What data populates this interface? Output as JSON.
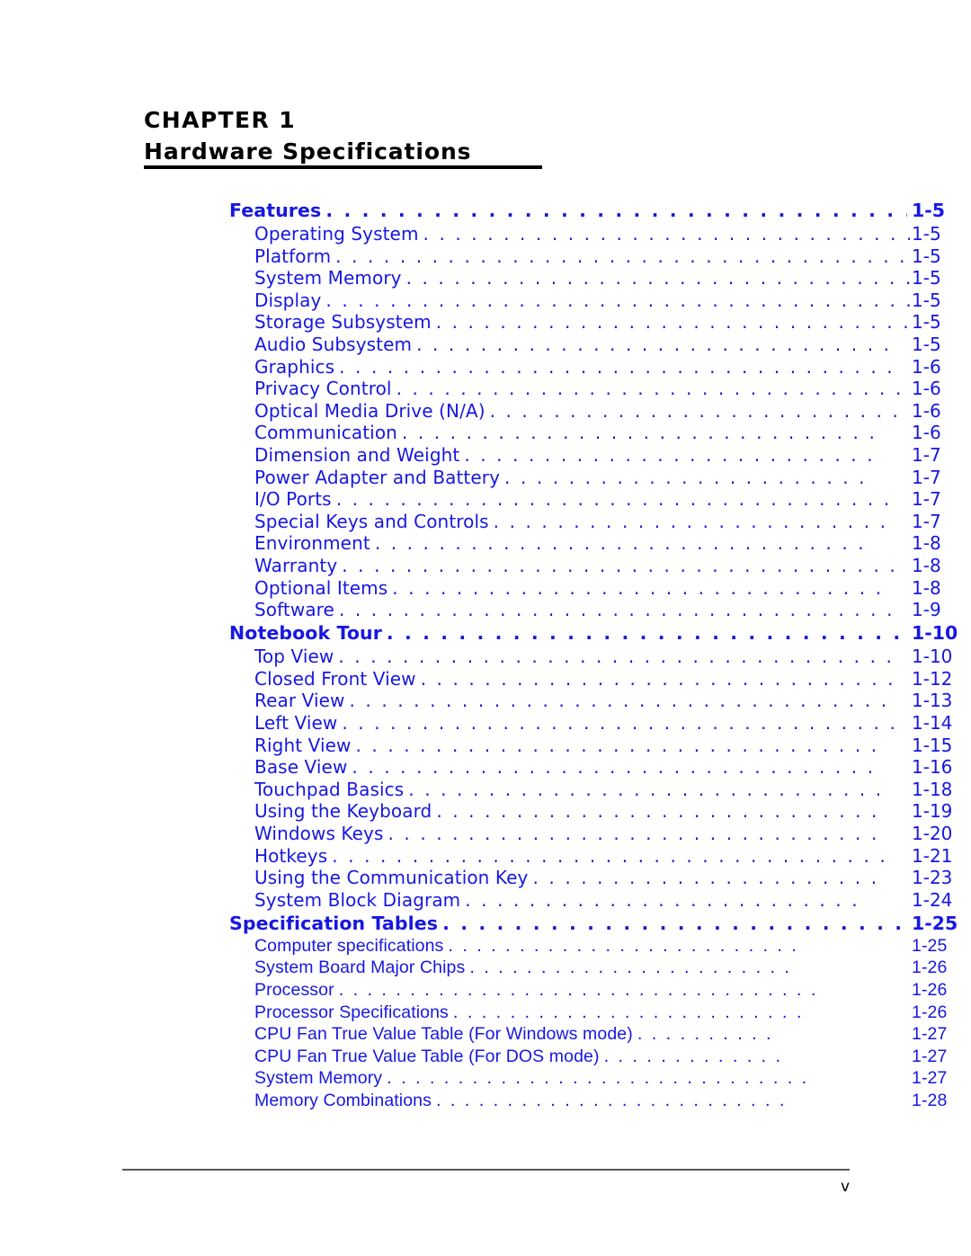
{
  "document": {
    "chapter_label": "CHAPTER 1",
    "chapter_title": "Hardware Specifications",
    "footer_page_number": "v",
    "accent_color": "#1717E2",
    "rule_color": "#000000",
    "footer_rule_color": "#58585A"
  },
  "toc": {
    "entries": [
      {
        "level": 1,
        "label": "Features",
        "page": "1-5",
        "leader": ". . . . . . . . . . . . . . . . . . . . . . . . . . . . . . . . . . ."
      },
      {
        "level": 2,
        "label": "Operating System",
        "page": "1-5",
        "leader": ". . . . . . . . . . . . . . . . . . . . . . . . . . . . . . . . ."
      },
      {
        "level": 2,
        "label": "Platform",
        "page": "1-5",
        "leader": ". . . . . . . . . . . . . . . . . . . . . . . . . . . . . . . . . . . ."
      },
      {
        "level": 2,
        "label": "System Memory",
        "page": "1-5",
        "leader": ". . . . . . . . . . . . . . . . . . . . . . . . . . . . . . . . ."
      },
      {
        "level": 2,
        "label": "Display",
        "page": "1-5",
        "leader": ". . . . . . . . . . . . . . . . . . . . . . . . . . . . . . . . . . . . ."
      },
      {
        "level": 2,
        "label": "Storage Subsystem",
        "page": "1-5",
        "leader": ". . . . . . . . . . . . . . . . . . . . . . . . . . . . . ."
      },
      {
        "level": 2,
        "label": "Audio Subsystem",
        "page": "1-5",
        "leader": ". . . . . . . . . . . . . . . . . . . . . . . . . . . . . ."
      },
      {
        "level": 2,
        "label": "Graphics",
        "page": "1-6",
        "leader": ". . . . . . . . . . . . . . . . . . . . . . . . . . . . . . . . . . ."
      },
      {
        "level": 2,
        "label": "Privacy Control",
        "page": "1-6",
        "leader": ". . . . . . . . . . . . . . . . . . . . . . . . . . . . . . . ."
      },
      {
        "level": 2,
        "label": "Optical Media Drive (N/A)",
        "page": "1-6",
        "leader": ". . . . . . . . . . . . . . . . . . . . . . . . . ."
      },
      {
        "level": 2,
        "label": "Communication",
        "page": "1-6",
        "leader": ". . . . . . . . . . . . . . . . . . . . . . . . . . . . . ."
      },
      {
        "level": 2,
        "label": "Dimension and Weight",
        "page": "1-7",
        "leader": ". . . . . . . . . . . . . . . . . . . . . . . . . ."
      },
      {
        "level": 2,
        "label": "Power Adapter and Battery",
        "page": "1-7",
        "leader": ". . . . . . . . . . . . . . . . . . . . . . ."
      },
      {
        "level": 2,
        "label": "I/O Ports",
        "page": "1-7",
        "leader": ". . . . . . . . . . . . . . . . . . . . . . . . . . . . . . . . . . ."
      },
      {
        "level": 2,
        "label": "Special Keys and Controls",
        "page": "1-7",
        "leader": ". . . . . . . . . . . . . . . . . . . . . . . . ."
      },
      {
        "level": 2,
        "label": "Environment",
        "page": "1-8",
        "leader": ". . . . . . . . . . . . . . . . . . . . . . . . . . . . . . ."
      },
      {
        "level": 2,
        "label": "Warranty",
        "page": "1-8",
        "leader": ". . . . . . . . . . . . . . . . . . . . . . . . . . . . . . . . . . ."
      },
      {
        "level": 2,
        "label": "Optional Items",
        "page": "1-8",
        "leader": ". . . . . . . . . . . . . . . . . . . . . . . . . . . . . . ."
      },
      {
        "level": 2,
        "label": "Software",
        "page": "1-9",
        "leader": ". . . . . . . . . . . . . . . . . . . . . . . . . . . . . . . . . . ."
      },
      {
        "level": 1,
        "label": "Notebook Tour",
        "page": "1-10",
        "leader": ". . . . . . . . . . . . . . . . . . . . . . . . . . . . . . . . . ."
      },
      {
        "level": 2,
        "label": "Top View",
        "page": "1-10",
        "leader": ". . . . . . . . . . . . . . . . . . . . . . . . . . . . . . . . . . ."
      },
      {
        "level": 2,
        "label": "Closed Front View",
        "page": "1-12",
        "leader": ". . . . . . . . . . . . . . . . . . . . . . . . . . . . . ."
      },
      {
        "level": 2,
        "label": "Rear View",
        "page": "1-13",
        "leader": ". . . . . . . . . . . . . . . . . . . . . . . . . . . . . . . . . ."
      },
      {
        "level": 2,
        "label": "Left View",
        "page": "1-14",
        "leader": ". . . . . . . . . . . . . . . . . . . . . . . . . . . . . . . . . . ."
      },
      {
        "level": 2,
        "label": "Right View",
        "page": "1-15",
        "leader": ". . . . . . . . . . . . . . . . . . . . . . . . . . . . . . . . ."
      },
      {
        "level": 2,
        "label": "Base View",
        "page": "1-16",
        "leader": ". . . . . . . . . . . . . . . . . . . . . . . . . . . . . . . . ."
      },
      {
        "level": 2,
        "label": "Touchpad Basics",
        "page": "1-18",
        "leader": ". . . . . . . . . . . . . . . . . . . . . . . . . . . . . ."
      },
      {
        "level": 2,
        "label": "Using the Keyboard",
        "page": "1-19",
        "leader": ". . . . . . . . . . . . . . . . . . . . . . . . . . . ."
      },
      {
        "level": 2,
        "label": "Windows Keys",
        "page": "1-20",
        "leader": ". . . . . . . . . . . . . . . . . . . . . . . . . . . . . . ."
      },
      {
        "level": 2,
        "label": "Hotkeys",
        "page": "1-21",
        "leader": ". . . . . . . . . . . . . . . . . . . . . . . . . . . . . . . . . . ."
      },
      {
        "level": 2,
        "label": "Using the Communication Key",
        "page": "1-23",
        "leader": ". . . . . . . . . . . . . . . . . . . . . ."
      },
      {
        "level": 2,
        "label": "System Block Diagram",
        "page": "1-24",
        "leader": ". . . . . . . . . . . . . . . . . . . . . . . . ."
      },
      {
        "level": 1,
        "label": "Specification Tables",
        "page": "1-25",
        "leader": ". . . . . . . . . . . . . . . . . . . . . . . . . . . . . ."
      },
      {
        "level": 2,
        "label": "Computer specifications",
        "page": "1-25",
        "leader": ". . . . . . . . . . . . . . . . . . . . . . . . ."
      },
      {
        "level": 2,
        "label": "System Board Major Chips",
        "page": "1-26",
        "leader": ". . . . . . . . . . . . . . . . . . . . . . ."
      },
      {
        "level": 2,
        "label": "Processor",
        "page": "1-26",
        "leader": ". . . . . . . . . . . . . . . . . . . . . . . . . . . . . . . . . ."
      },
      {
        "level": 2,
        "label": "Processor Specifications",
        "page": "1-26",
        "leader": ". . . . . . . . . . . . . . . . . . . . . . . . ."
      },
      {
        "level": 2,
        "label": "CPU Fan True Value Table (For Windows mode)",
        "page": "1-27",
        "leader": ". . . . . . . . . ."
      },
      {
        "level": 2,
        "label": "CPU Fan True Value Table (For DOS mode)",
        "page": "1-27",
        "leader": ". . . . . . . . . . . . ."
      },
      {
        "level": 2,
        "label": "System Memory",
        "page": "1-27",
        "leader": ". . . . . . . . . . . . . . . . . . . . . . . . . . . . . ."
      },
      {
        "level": 2,
        "label": "Memory Combinations",
        "page": "1-28",
        "leader": ". . . . . . . . . . . . . . . . . . . . . . . . ."
      }
    ]
  }
}
